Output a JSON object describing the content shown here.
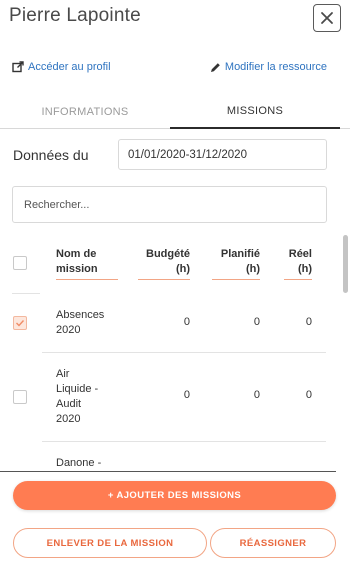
{
  "header": {
    "title": "Pierre Lapointe"
  },
  "links": {
    "profile": "Accéder au profil",
    "edit_resource": "Modifier la ressource"
  },
  "tabs": [
    {
      "label": "INFORMATIONS",
      "active": false
    },
    {
      "label": "MISSIONS",
      "active": true
    }
  ],
  "period": {
    "label": "Données du",
    "start": "01/01/2020",
    "separator": "-",
    "end": "31/12/2020"
  },
  "search": {
    "placeholder": "Rechercher..."
  },
  "table": {
    "columns": [
      {
        "line1": "Nom de",
        "line2": "mission"
      },
      {
        "line1": "Budgété",
        "line2": "(h)"
      },
      {
        "line1": "Planifié",
        "line2": "(h)"
      },
      {
        "line1": "Réel",
        "line2": "(h)"
      }
    ],
    "rows": [
      {
        "name_lines": [
          "Absences",
          "2020"
        ],
        "checked": true,
        "budgeted": "0",
        "planned": "0",
        "actual": "0"
      },
      {
        "name_lines": [
          "Air",
          "Liquide -",
          "Audit",
          "2020"
        ],
        "checked": false,
        "budgeted": "0",
        "planned": "0",
        "actual": "0"
      },
      {
        "name_lines": [
          "Danone -"
        ],
        "checked": false,
        "budgeted": "",
        "planned": "",
        "actual": ""
      }
    ]
  },
  "buttons": {
    "add": "+ AJOUTER DES MISSIONS",
    "remove": "ENLEVER DE LA MISSION",
    "reassign": "RÉASSIGNER"
  },
  "colors": {
    "accent": "#ff7c52",
    "link": "#2f74c0",
    "accent_light": "#f2a585"
  }
}
